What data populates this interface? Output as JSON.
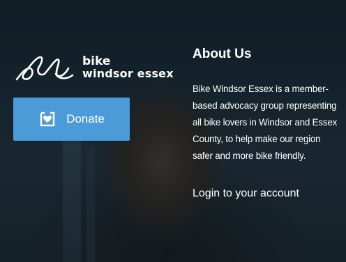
{
  "logo": {
    "line1": "bike",
    "line2": "windsor essex",
    "icon": "bicycle-logo-icon"
  },
  "donate": {
    "label": "Donate",
    "icon": "heart-page-icon",
    "color": "#4a9bd8"
  },
  "about": {
    "title": "About Us",
    "body": "Bike Windsor Essex is a member-based advocacy group representing all bike lovers in Windsor and Essex County, to help make our region safer and more bike friendly."
  },
  "login": {
    "label": "Login to your account"
  }
}
